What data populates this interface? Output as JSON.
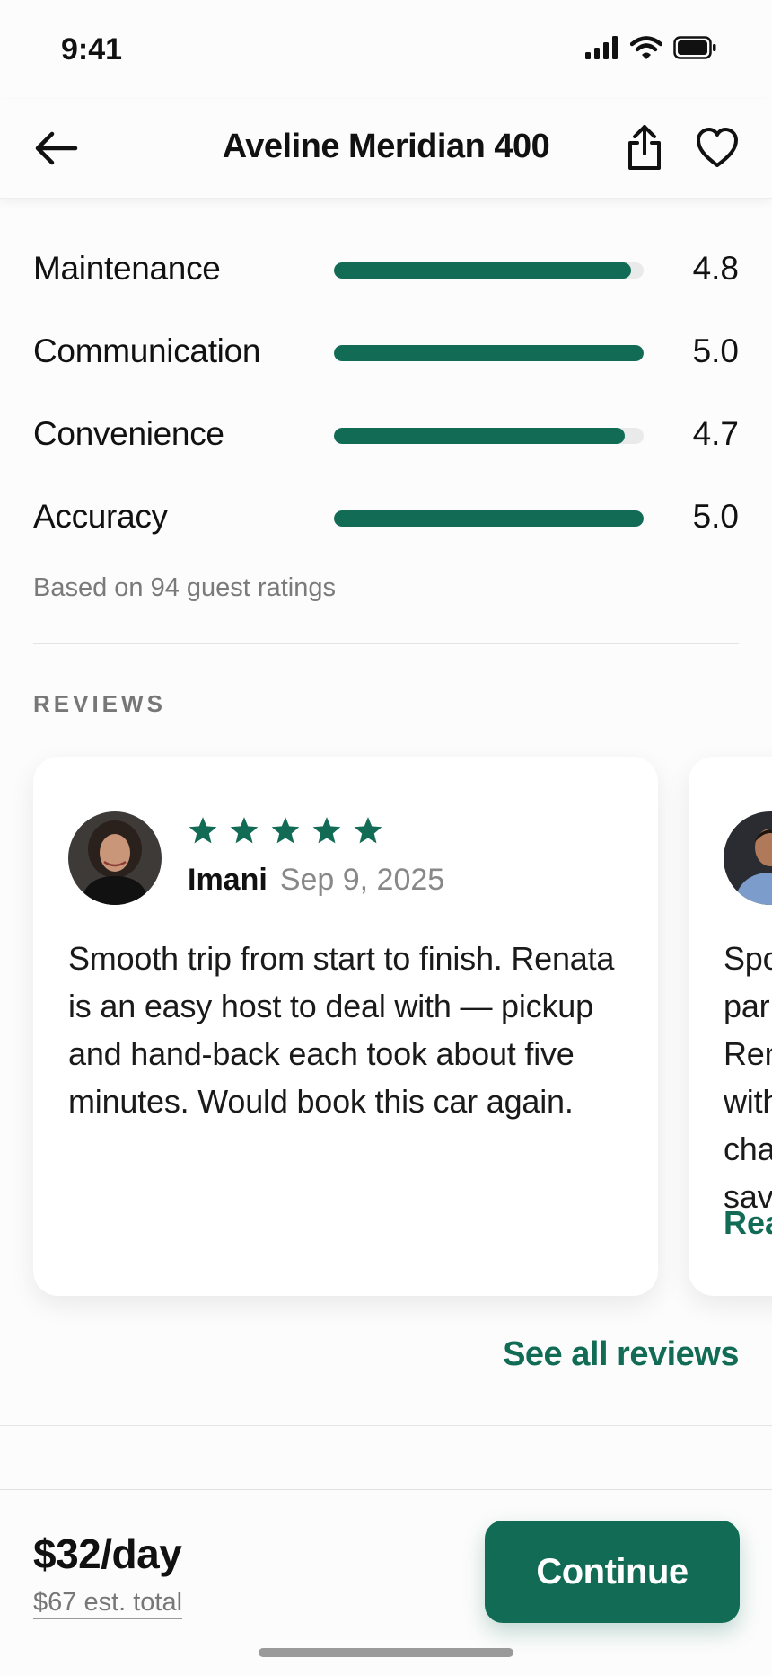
{
  "status_bar": {
    "time": "9:41"
  },
  "header": {
    "title": "Aveline Meridian 400"
  },
  "ratings": [
    {
      "label": "Maintenance",
      "value": "4.8",
      "fraction": 0.96
    },
    {
      "label": "Communication",
      "value": "5.0",
      "fraction": 1.0
    },
    {
      "label": "Convenience",
      "value": "4.7",
      "fraction": 0.94
    },
    {
      "label": "Accuracy",
      "value": "5.0",
      "fraction": 1.0
    }
  ],
  "based_on": "Based on 94 guest ratings",
  "reviews_heading": "REVIEWS",
  "reviews": [
    {
      "name": "Imani",
      "date": "Sep 9, 2025",
      "stars": 5,
      "text": "Smooth trip from start to finish. Renata is an easy host to deal with — pickup and hand-back each took about five minutes. Would book this car again."
    },
    {
      "text_visible_fragment": "Spo par Ren with cha sav",
      "read_more_fragment": "Rea"
    }
  ],
  "see_all": "See all reviews",
  "footer": {
    "price": "$32/day",
    "est_total": "$67 est. total",
    "continue": "Continue"
  },
  "colors": {
    "accent": "#116b55",
    "track": "#eaeaea",
    "muted": "#777777"
  },
  "icons": {
    "back": "arrow-left-icon",
    "share": "share-icon",
    "favorite": "heart-icon",
    "star": "star-icon",
    "signal": "signal-icon",
    "wifi": "wifi-icon",
    "battery": "battery-icon"
  }
}
